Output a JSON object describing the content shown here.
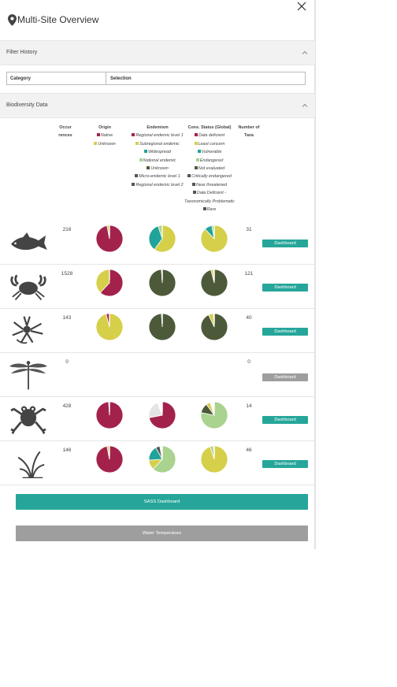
{
  "header": {
    "title": "Multi-Site Overview"
  },
  "filter_history": {
    "label": "Filter History",
    "col_category": "Category",
    "col_selection": "Selection"
  },
  "biodiversity": {
    "label": "Biodiversity Data"
  },
  "columns": {
    "occurrences_1": "Occur",
    "occurrences_2": "rences",
    "origin": "Origin",
    "endemism": "Endemism",
    "cons_status": "Cons. Status (Global)",
    "taxa_1": "Number of",
    "taxa_2": "Taxa"
  },
  "legends": {
    "origin": [
      {
        "label": "Native",
        "color": "#a3224b"
      },
      {
        "label": "Unknown",
        "color": "#d6cf4a"
      }
    ],
    "endemism": [
      {
        "label": "Regional endemic level 1",
        "color": "#a3224b"
      },
      {
        "label": "Subregional endemic",
        "color": "#d6cf4a"
      },
      {
        "label": "Widespread",
        "color": "#1fa39a"
      },
      {
        "label": "National endemic",
        "color": "#a9d38e"
      },
      {
        "label": "Unknown",
        "color": "#4c5a3a"
      },
      {
        "label": "Micro-endemic level 1",
        "color": "#555555"
      },
      {
        "label": "Regional endemic level 2",
        "color": "#555555"
      }
    ],
    "cons_status": [
      {
        "label": "Data deficient",
        "color": "#a3224b"
      },
      {
        "label": "Least concern",
        "color": "#d6cf4a"
      },
      {
        "label": "Vulnerable",
        "color": "#1fa39a"
      },
      {
        "label": "Endangered",
        "color": "#a9d38e"
      },
      {
        "label": "Not evaluated",
        "color": "#4c5a3a"
      },
      {
        "label": "Critically endangered",
        "color": "#555555"
      },
      {
        "label": "Near threatened",
        "color": "#555555"
      },
      {
        "label": "Data Deficient - Taxonomically Problematic",
        "color": "#555555"
      },
      {
        "label": "Rare",
        "color": "#555555"
      }
    ]
  },
  "colors": {
    "maroon": "#a3224b",
    "yellow": "#d6cf4a",
    "teal": "#1fa39a",
    "light_green": "#a9d38e",
    "dark_green": "#4c5a3a",
    "grey": "#555555",
    "light_grey": "#e4e4e4",
    "accent": "#26a69a",
    "disabled": "#9e9e9e"
  },
  "rows": [
    {
      "taxon_icon": "fish-icon",
      "occurrences": "216",
      "taxa": "31",
      "dashboard_label": "Dashboard",
      "enabled": true,
      "origin": [
        {
          "value": 97,
          "color": "#a3224b"
        },
        {
          "value": 3,
          "color": "#d6cf4a"
        }
      ],
      "endemism": [
        {
          "value": 60,
          "color": "#d6cf4a"
        },
        {
          "value": 35,
          "color": "#1fa39a"
        },
        {
          "value": 5,
          "color": "#a9d38e"
        }
      ],
      "cons_status": [
        {
          "value": 88,
          "color": "#d6cf4a"
        },
        {
          "value": 9,
          "color": "#1fa39a"
        },
        {
          "value": 3,
          "color": "#a9d38e"
        }
      ]
    },
    {
      "taxon_icon": "crab-icon",
      "occurrences": "1528",
      "taxa": "121",
      "dashboard_label": "Dashboard",
      "enabled": true,
      "origin": [
        {
          "value": 62,
          "color": "#a3224b"
        },
        {
          "value": 38,
          "color": "#d6cf4a"
        }
      ],
      "endemism": [
        {
          "value": 99,
          "color": "#4c5a3a"
        },
        {
          "value": 1,
          "color": "#ffffff"
        }
      ],
      "cons_status": [
        {
          "value": 96,
          "color": "#4c5a3a"
        },
        {
          "value": 3,
          "color": "#d6cf4a"
        },
        {
          "value": 1,
          "color": "#ffffff"
        }
      ]
    },
    {
      "taxon_icon": "invertebrate-icon",
      "occurrences": "143",
      "taxa": "40",
      "dashboard_label": "Dashboard",
      "enabled": true,
      "origin": [
        {
          "value": 96,
          "color": "#d6cf4a"
        },
        {
          "value": 4,
          "color": "#a3224b"
        }
      ],
      "endemism": [
        {
          "value": 99,
          "color": "#4c5a3a"
        },
        {
          "value": 1,
          "color": "#ffffff"
        }
      ],
      "cons_status": [
        {
          "value": 93,
          "color": "#4c5a3a"
        },
        {
          "value": 6,
          "color": "#d6cf4a"
        },
        {
          "value": 1,
          "color": "#ffffff"
        }
      ]
    },
    {
      "taxon_icon": "dragonfly-icon",
      "occurrences": "0",
      "taxa": "0",
      "dashboard_label": "Dashboard",
      "enabled": false,
      "origin": [],
      "endemism": [],
      "cons_status": []
    },
    {
      "taxon_icon": "frog-icon",
      "occurrences": "428",
      "taxa": "14",
      "dashboard_label": "Dashboard",
      "enabled": true,
      "origin": [
        {
          "value": 99,
          "color": "#a3224b"
        },
        {
          "value": 1,
          "color": "#ffffff"
        }
      ],
      "endemism": [
        {
          "value": 72,
          "color": "#a3224b"
        },
        {
          "value": 22,
          "color": "#e4e4e4"
        },
        {
          "value": 6,
          "color": "#ffffff"
        }
      ],
      "cons_status": [
        {
          "value": 78,
          "color": "#a9d38e"
        },
        {
          "value": 12,
          "color": "#4c5a3a"
        },
        {
          "value": 5,
          "color": "#d6cf4a"
        },
        {
          "value": 5,
          "color": "#ffffff"
        }
      ]
    },
    {
      "taxon_icon": "plant-icon",
      "occurrences": "146",
      "taxa": "46",
      "dashboard_label": "Dashboard",
      "enabled": true,
      "origin": [
        {
          "value": 97,
          "color": "#a3224b"
        },
        {
          "value": 3,
          "color": "#d6cf4a"
        }
      ],
      "endemism": [
        {
          "value": 62,
          "color": "#a9d38e"
        },
        {
          "value": 12,
          "color": "#d6cf4a"
        },
        {
          "value": 18,
          "color": "#1fa39a"
        },
        {
          "value": 5,
          "color": "#555555"
        },
        {
          "value": 3,
          "color": "#ffffff"
        }
      ],
      "cons_status": [
        {
          "value": 95,
          "color": "#d6cf4a"
        },
        {
          "value": 4,
          "color": "#a9d38e"
        },
        {
          "value": 1,
          "color": "#ffffff"
        }
      ]
    }
  ],
  "buttons": {
    "sass": "SASS Dashboard",
    "water": "Water Temperature"
  }
}
